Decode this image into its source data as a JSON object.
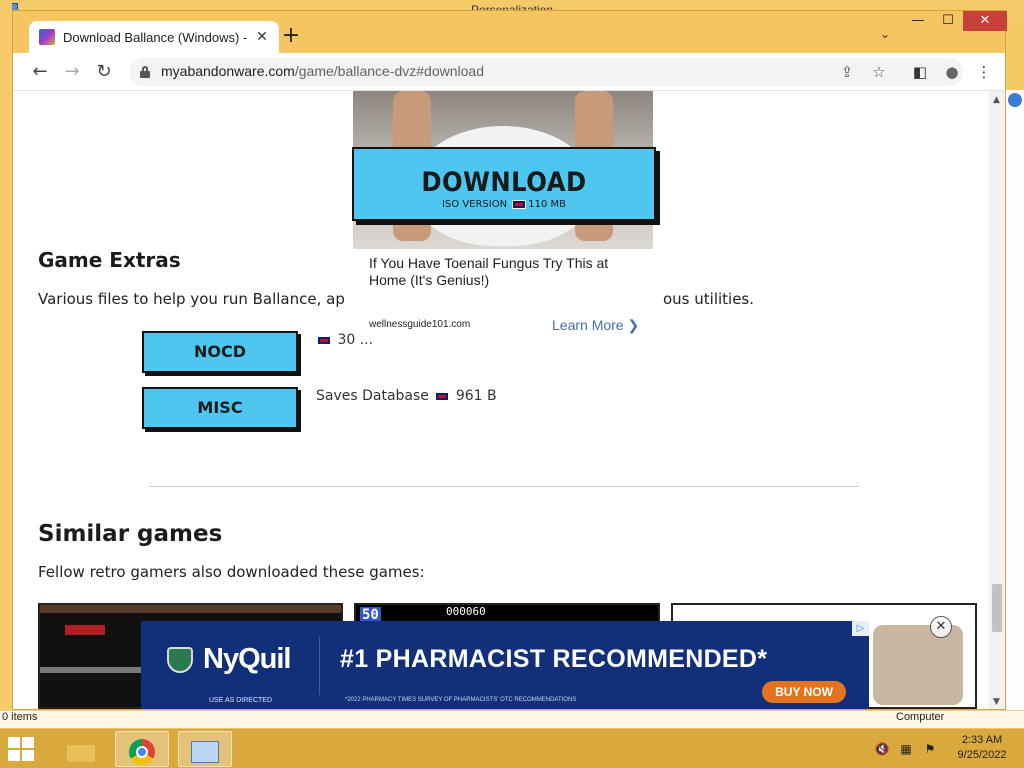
{
  "desktop": {
    "background_window_title": "Personalization",
    "status_left": "0 items",
    "status_right": "Computer"
  },
  "browser": {
    "tab": {
      "title": "Download Ballance (Windows) - ",
      "close": "✕"
    },
    "new_tab": "+",
    "tab_search": "⌄",
    "window_controls": {
      "minimize": "—",
      "maximize": "☐",
      "close": "✕"
    },
    "nav": {
      "back": "←",
      "forward": "→",
      "reload": "↻"
    },
    "address": {
      "domain": "myabandonware.com",
      "path": "/game/ballance-dvz#download"
    },
    "toolbar_icons": {
      "share": "⇪",
      "bookmark": "☆",
      "side_panel": "◧",
      "profile": "●",
      "menu": "⋮"
    }
  },
  "page": {
    "download": {
      "label": "DOWNLOAD",
      "version": "ISO VERSION",
      "size": "110 MB"
    },
    "native_ad": {
      "headline": "If You Have Toenail Fungus Try This at Home (It's Genius!)",
      "domain": "wellnessguide101.com",
      "cta": "Learn More ❯"
    },
    "extras": {
      "heading": "Game Extras",
      "description_left": "Various files to help you run Ballance, ap",
      "description_right": "ous utilities.",
      "items": [
        {
          "label": "NOCD",
          "meta_size": "30 ..."
        },
        {
          "label": "MISC",
          "meta_desc": "Saves Database",
          "meta_size": "961 B"
        }
      ]
    },
    "similar": {
      "heading": "Similar games",
      "description": "Fellow retro gamers also downloaded these games:",
      "thumb2_score": "000060",
      "thumb2_lives": "50"
    }
  },
  "banner_ad": {
    "brand": "NyQuil",
    "use_as_directed": "USE AS DIRECTED",
    "headline": "#1 PHARMACIST RECOMMENDED*",
    "footnote": "*2022 PHARMACY TIMES SURVEY OF PHARMACISTS' OTC RECOMMENDATIONS",
    "buy_now": "BUY NOW",
    "adchoices": "▷",
    "close": "✕"
  },
  "taskbar": {
    "clock_time": "2:33 AM",
    "clock_date": "9/25/2022"
  },
  "colors": {
    "accent_button": "#4dc6f0",
    "window_frame": "#f5c562",
    "banner_bg": "#12307a",
    "buy_now": "#e3731e"
  }
}
